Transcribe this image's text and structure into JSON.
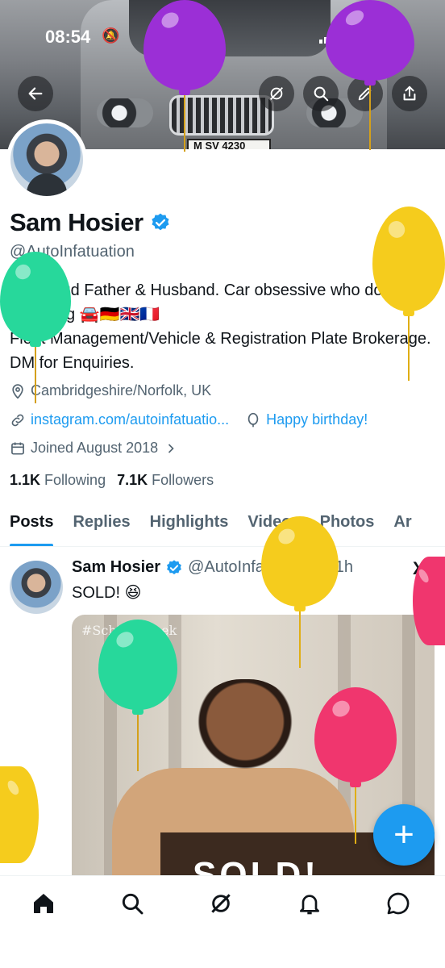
{
  "status_bar": {
    "time": "08:54",
    "battery": "100"
  },
  "banner": {
    "plate": "M SV 4230"
  },
  "profile": {
    "name": "Sam Hosier",
    "handle": "@AutoInfatuation",
    "bio_lines": [
      "36, Proud Father & Husband. Car obsessive who does a lot of driving 🚘🇩🇪🇬🇧🇫🇷",
      "Fleet Management/Vehicle & Registration Plate Brokerage. DM for Enquiries."
    ],
    "location": "Cambridgeshire/Norfolk, UK",
    "website": "instagram.com/autoinfatuatio...",
    "birthday": "Happy birthday!",
    "joined": "Joined August 2018",
    "following_count": "1.1K",
    "following_label": "Following",
    "followers_count": "7.1K",
    "followers_label": "Followers"
  },
  "tabs": [
    "Posts",
    "Replies",
    "Highlights",
    "Videos",
    "Photos",
    "Ar"
  ],
  "active_tab": "Posts",
  "post": {
    "name": "Sam Hosier",
    "handle": "@AutoInfatuation",
    "time": "· 11h",
    "text": "SOLD! 😆",
    "gif_caption": "SOLD!",
    "watermark": "#SchittsCreek"
  },
  "fab_label": "+",
  "colors": {
    "accent": "#1d9bf0",
    "text_primary": "#0f1419",
    "text_secondary": "#536471"
  },
  "icons": {
    "back": "arrow-left-icon",
    "grok": "grok-icon",
    "search": "search-icon",
    "edit": "edit-icon",
    "share": "share-icon",
    "home": "home-icon",
    "explore": "search-icon",
    "grok_nav": "grok-icon",
    "notifications": "bell-icon",
    "messages": "chat-icon"
  }
}
